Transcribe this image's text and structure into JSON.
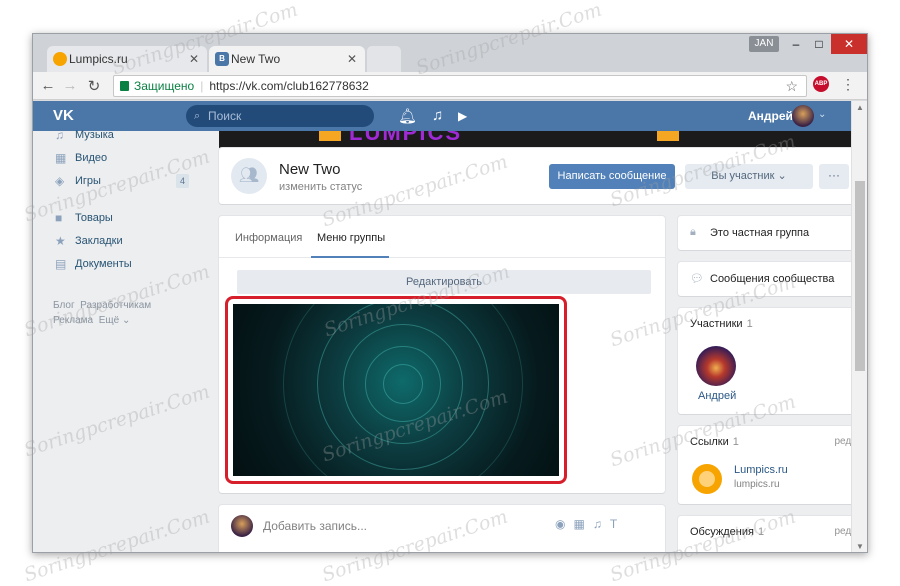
{
  "browser": {
    "tabs": [
      {
        "title": "Lumpics.ru",
        "icon": "orange-slice-icon"
      },
      {
        "title": "New Two",
        "icon": "vk-icon"
      }
    ],
    "profile_badge": "JAN",
    "secure_label": "Защищено",
    "url": "https://vk.com/club162778632",
    "adblock_badge": "ABP"
  },
  "vk_header": {
    "logo": "VK",
    "search_placeholder": "Поиск",
    "user_name": "Андрей"
  },
  "left_menu": {
    "items": [
      {
        "label": "Музыка",
        "icon": "music-icon"
      },
      {
        "label": "Видео",
        "icon": "video-icon"
      },
      {
        "label": "Игры",
        "icon": "gamepad-icon",
        "count": "4"
      },
      {
        "label": "Товары",
        "icon": "bag-icon"
      },
      {
        "label": "Закладки",
        "icon": "star-icon"
      },
      {
        "label": "Документы",
        "icon": "document-icon"
      }
    ],
    "footer": {
      "blog": "Блог",
      "developers": "Разработчикам",
      "ads": "Реклама",
      "more": "Ещё"
    }
  },
  "banner": {
    "text": "LUMPICS"
  },
  "group": {
    "name": "New Two",
    "status_placeholder": "изменить статус",
    "write_button": "Написать сообщение",
    "member_button": "Вы участник",
    "more_button": "···"
  },
  "content": {
    "tabs": [
      {
        "label": "Информация",
        "active": false
      },
      {
        "label": "Меню группы",
        "active": true
      }
    ],
    "edit_button": "Редактировать"
  },
  "post": {
    "placeholder": "Добавить запись..."
  },
  "right": {
    "private_group": "Это частная группа",
    "community_messages": "Сообщения сообщества",
    "members": {
      "title": "Участники",
      "count": "1",
      "member_name": "Андрей"
    },
    "links": {
      "title": "Ссылки",
      "count": "1",
      "edit": "ред.",
      "name": "Lumpics.ru",
      "url": "lumpics.ru"
    },
    "discussions": {
      "title": "Обсуждения",
      "count": "1",
      "edit": "ред."
    }
  },
  "watermark": "Soringpcrepair.Com",
  "colors": {
    "vk_blue": "#4a76a8",
    "accent_button": "#5181b8",
    "highlight_red": "#d61f2a"
  }
}
